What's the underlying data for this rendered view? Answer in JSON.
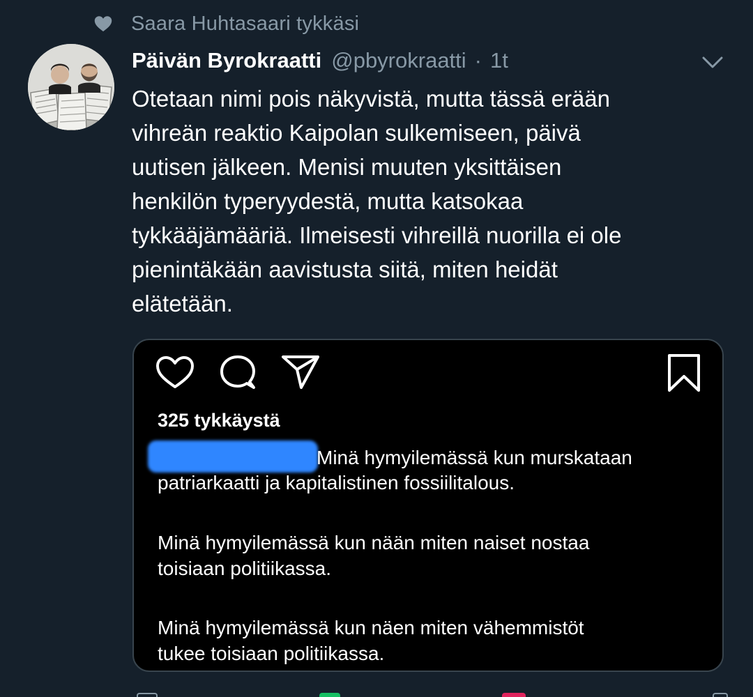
{
  "social_context": {
    "text": "Saara Huhtasaari tykkäsi",
    "icon": "heart-icon"
  },
  "tweet": {
    "display_name": "Päivän Byrokraatti",
    "handle": "@pbyrokraatti",
    "separator": "·",
    "time": "1t",
    "text": "Otetaan nimi pois näkyvistä, mutta tässä erään\nvihreän reaktio Kaipolan sulkemiseen, päivä\nuutisen jälkeen. Menisi muuten yksittäisen\nhenkilön typeryydestä, mutta katsokaa\ntykkääjämääriä. Ilmeisesti vihreillä nuorilla ei ole\npienintäkään aavistusta siitä, miten heidät\nelätetään."
  },
  "media": {
    "icons": [
      "heart-icon",
      "comment-icon",
      "share-icon",
      "bookmark-icon"
    ],
    "likes": "325 tykkäystä",
    "caption_first_line": "Minä hymyilemässä kun murskataan",
    "caption_second_line": "patriarkaatti ja kapitalistinen fossiilitalous.",
    "paragraph2": "Minä hymyilemässä kun nään miten naiset nostaa\ntoisiaan politiikassa.",
    "paragraph3": "Minä hymyilemässä kun näen miten vähemmistöt\ntukee toisiaan politiikassa."
  },
  "colors": {
    "background": "#15202b",
    "secondary_text": "#8899a6",
    "redaction": "#2f86ff"
  }
}
